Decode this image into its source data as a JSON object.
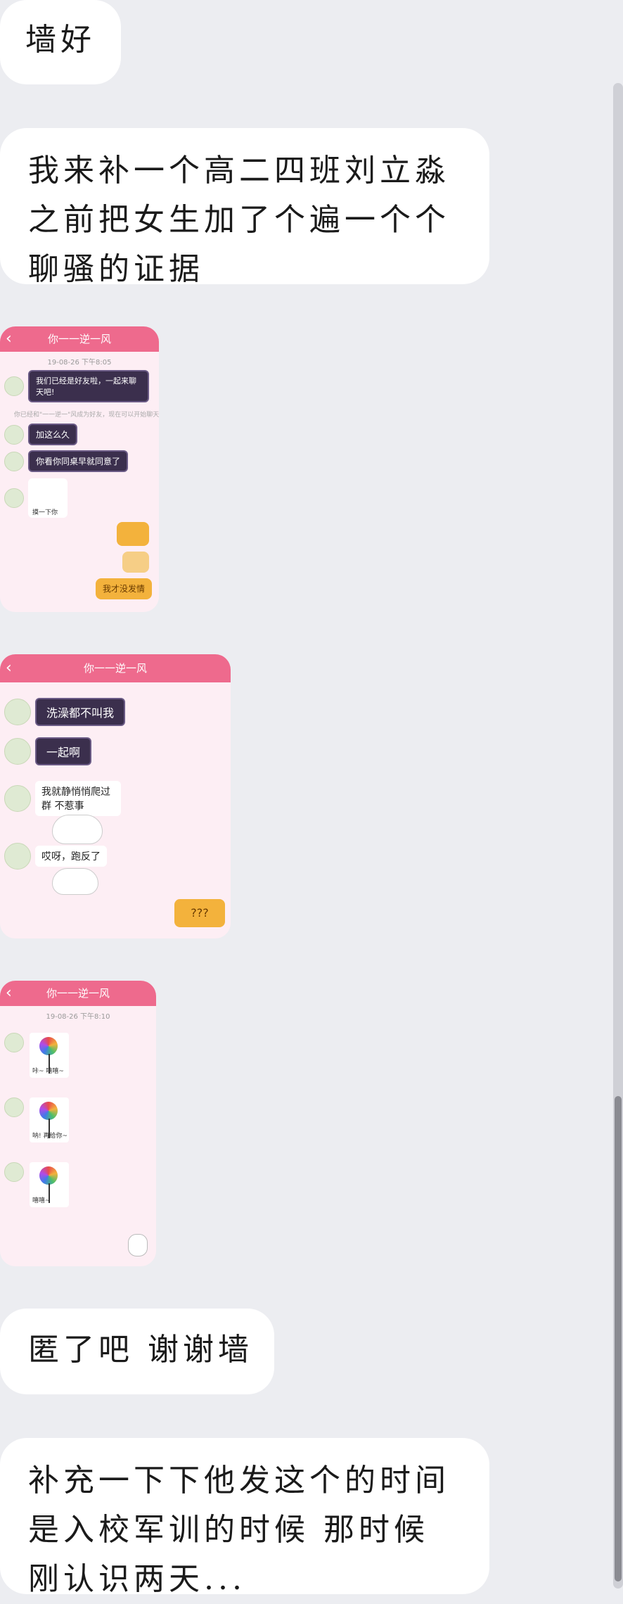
{
  "messages": [
    {
      "lines": [
        "墙好"
      ]
    },
    {
      "lines": [
        "我来补一个高二四班刘立淼",
        "之前把女生加了个遍一个个",
        "聊骚的证据"
      ]
    },
    {
      "lines": [
        "匿了吧 谢谢墙"
      ]
    },
    {
      "lines": [
        "补充一下下他发这个的时间",
        "是入校军训的时候 那时候",
        "刚认识两天..."
      ]
    }
  ],
  "screenshot1": {
    "title": "你一一逆一风",
    "time": "19-08-26 下午8:05",
    "msg1": "我们已经是好友啦，一起来聊天吧!",
    "system": "你已经和\"一一逆一\"风成为好友，现在可以开始聊天了。",
    "msg2": "加这么久",
    "msg3": "你看你同桌早就同意了",
    "sticker_caption": "摸一下你",
    "sticker_text": "我才没发情"
  },
  "screenshot2": {
    "title": "你一一逆一风",
    "msg1": "洗澡都不叫我",
    "msg2": "一起啊",
    "msg3": "我就静悄悄爬过群 不惹事",
    "msg4": "哎呀，跑反了",
    "sticker_text": "???"
  },
  "screenshot3": {
    "title": "你一一逆一风",
    "time": "19-08-26 下午8:10",
    "candy1": "咔~ 嘻嘻~",
    "candy2": "呐! 再给你~",
    "candy3": "嘻嘻~"
  },
  "colors": {
    "background": "#ecedf1",
    "bubble": "#ffffff",
    "header": "#ee6a8d"
  }
}
